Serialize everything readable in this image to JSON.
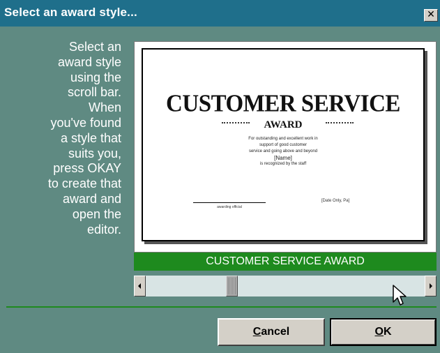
{
  "window": {
    "title": "Select an award style...",
    "close_glyph": "✕"
  },
  "instructions": {
    "lines": [
      "Select an",
      "award style",
      "using the",
      "scroll bar.",
      "When",
      "you've found",
      "a style that",
      "suits you,",
      "press OKAY",
      "to create that",
      "award and",
      "open the",
      "editor."
    ]
  },
  "preview": {
    "certificate_title": "CUSTOMER SERVICE",
    "certificate_subtitle": "AWARD",
    "body_lines": [
      "For outstanding and excellent work in",
      "support of good customer",
      "service and going above and beyond",
      "[Name]"
    ],
    "body_line5": "is recognized by the staff",
    "signature_label": "awarding official",
    "date_label": "[Date Only, Pa]"
  },
  "caption": "CUSTOMER SERVICE AWARD",
  "scrollbar": {
    "position": 0.3
  },
  "buttons": {
    "cancel": {
      "pre": "",
      "mnemonic": "C",
      "post": "ancel"
    },
    "ok": {
      "pre": "",
      "mnemonic": "O",
      "post": "K"
    }
  },
  "colors": {
    "titlebar": "#1f6f8b",
    "background": "#5f8a82",
    "accent_green": "#1e8a1e"
  },
  "icons": [
    "close-icon",
    "scroll-left-arrow-icon",
    "scroll-right-arrow-icon",
    "mouse-pointer-icon"
  ]
}
